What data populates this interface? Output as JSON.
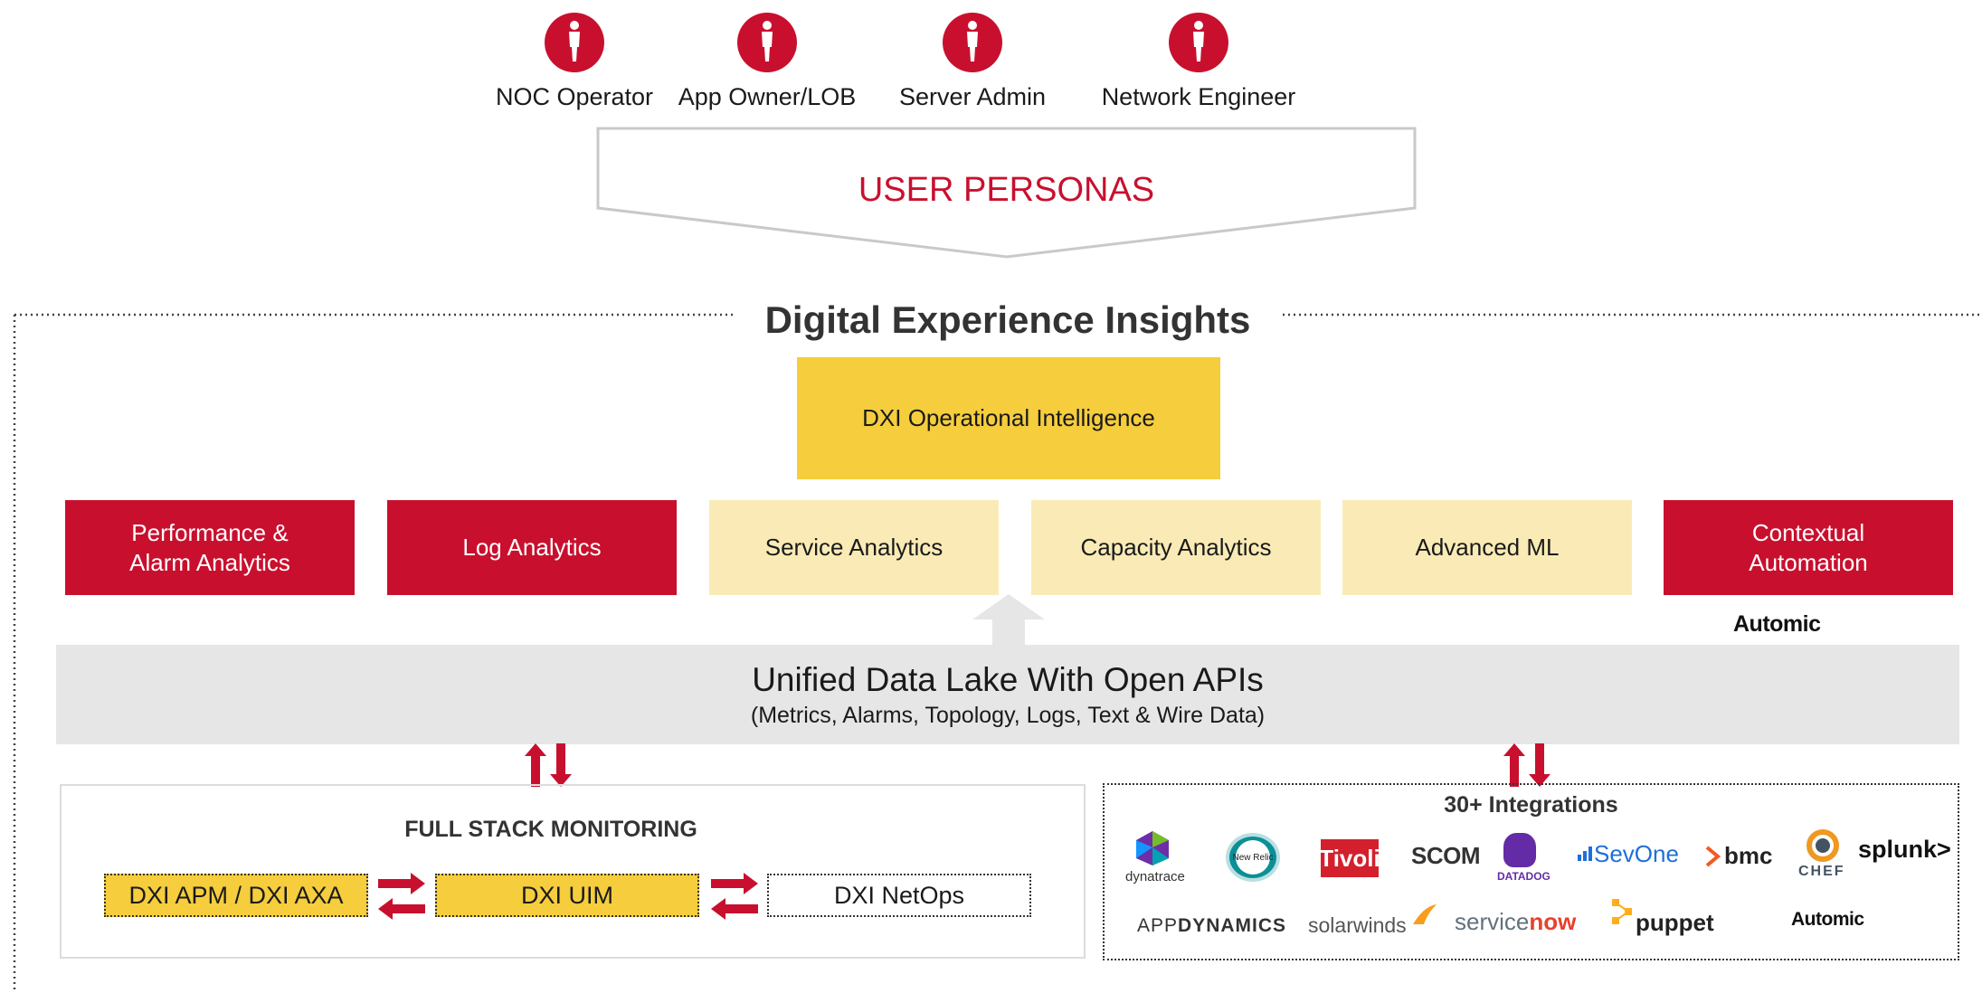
{
  "personas": [
    {
      "label": "NOC Operator",
      "icon": "person-icon"
    },
    {
      "label": "App Owner/LOB",
      "icon": "person-icon"
    },
    {
      "label": "Server Admin",
      "icon": "person-icon"
    },
    {
      "label": "Network Engineer",
      "icon": "person-icon"
    }
  ],
  "banner": {
    "label": "USER PERSONAS"
  },
  "main": {
    "title": "Digital Experience Insights",
    "oi": "DXI Operational Intelligence",
    "capabilities": [
      {
        "label": "Performance & Alarm Analytics",
        "style": "red"
      },
      {
        "label": "Log Analytics",
        "style": "red"
      },
      {
        "label": "Service Analytics",
        "style": "light"
      },
      {
        "label": "Capacity Analytics",
        "style": "light"
      },
      {
        "label": "Advanced  ML",
        "style": "light"
      },
      {
        "label": "Contextual Automation",
        "style": "red"
      }
    ],
    "automation_logo": "Automic",
    "lake": {
      "title": "Unified Data Lake With Open APIs",
      "subtitle": "(Metrics, Alarms, Topology, Logs, Text & Wire Data)"
    }
  },
  "fsm": {
    "title": "FULL STACK MONITORING",
    "items": [
      "DXI APM / DXI AXA",
      "DXI UIM",
      "DXI NetOps"
    ]
  },
  "integrations": {
    "title": "30+ Integrations",
    "row1": [
      "dynatrace",
      "New Relic",
      "Tivoli",
      "SCOM",
      "DATADOG",
      "SevOne",
      "bmc",
      "CHEF",
      "splunk>"
    ],
    "row2": [
      "APP",
      "DYNAMICS",
      "solarwinds",
      "service",
      "now",
      "puppet",
      "Automic"
    ]
  },
  "colors": {
    "brand_red": "#c8102e",
    "yellow": "#f5cd3d",
    "pale_yellow": "#faebb6",
    "lake_gray": "#e6e6e6"
  }
}
